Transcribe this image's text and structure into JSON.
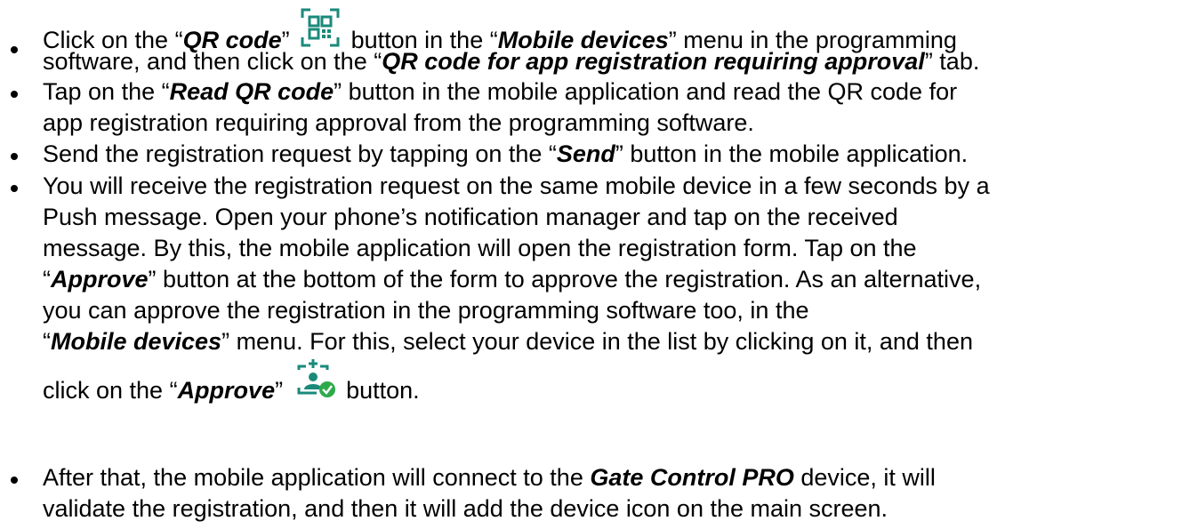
{
  "bullets": [
    {
      "lines": [
        [
          "Click on the “",
          "QR code",
          "” ",
          "[qr-icon]",
          " button in the “",
          "Mobile devices",
          "” menu in the programming"
        ],
        [
          "software, and then click on the “",
          "QR code for app registration requiring approval",
          "” tab."
        ]
      ]
    },
    {
      "lines": [
        [
          "Tap on the “",
          "Read QR code",
          "” button in the mobile application and read the QR code for"
        ],
        [
          "app registration requiring approval from the programming software."
        ]
      ]
    },
    {
      "lines": [
        [
          "Send the registration request by tapping on the “",
          "Send",
          "” button in the mobile application."
        ]
      ]
    },
    {
      "lines": [
        [
          "You will receive the registration request on the same mobile device in a few seconds by a"
        ],
        [
          "Push message. Open your phone’s notification manager and tap on the received"
        ],
        [
          "message. By this, the mobile application will open the registration form. Tap on the"
        ],
        [
          "“",
          "Approve",
          "” button at the bottom of the form to approve the registration. As an alternative,"
        ],
        [
          "you can approve the registration in the programming software too, in the"
        ],
        [
          "“",
          "Mobile devices",
          "” menu. For this, select your device in the list by clicking on it, and then"
        ],
        [
          "click on the “",
          "Approve",
          "” ",
          "[approve-icon]",
          " button."
        ]
      ]
    },
    {
      "lines": [
        [
          "After that, the mobile application will connect to the ",
          "Gate Control PRO",
          " device, it will"
        ],
        [
          "validate the registration, and then it will add the device icon on the main screen."
        ]
      ]
    }
  ],
  "icons": {
    "qr": "qr-code-icon",
    "approve": "approve-user-icon"
  },
  "colors": {
    "icon_teal": "#1a8a7a",
    "check_green": "#2eaa4a",
    "text": "#000000"
  }
}
